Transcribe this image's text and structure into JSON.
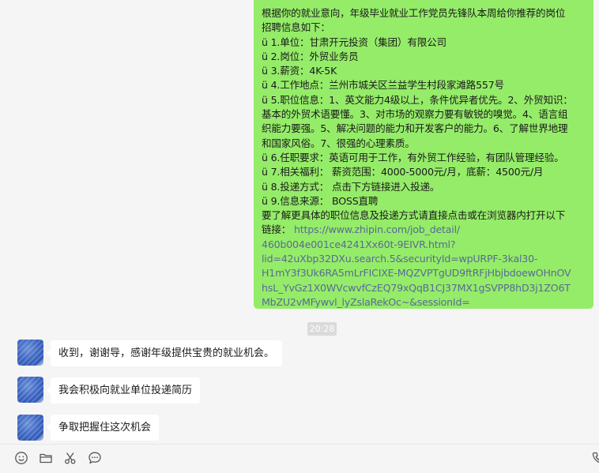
{
  "outgoing_message": {
    "lines": [
      "根据你的就业意向，年级毕业就业工作党员先锋队本周给你推荐的岗位",
      "招聘信息如下：",
      "ü 1.单位：甘肃开元投资（集团）有限公司",
      "ü 2.岗位：外贸业务员",
      "ü 3.薪资：4K-5K",
      "ü 4.工作地点：兰州市城关区兰益学生村段家滩路557号",
      "ü 5.职位信息：1、英文能力4级以上，条件优异者优先。2、外贸知识：",
      "基本的外贸术语要懂。3、对市场的观察力要有敏锐的嗅觉。4、语言组",
      "织能力要强。5、解决问题的能力和开发客户的能力。6、了解世界地理",
      "和国家风俗。7、很强的心理素质。",
      "ü 6.任职要求：英语可用于工作，有外贸工作经验，有团队管理经验。",
      "ü 7.相关福利： 薪资范围：4000-5000元/月，底薪：4500元/月",
      "ü 8.投递方式： 点击下方链接进入投递。",
      "ü 9.信息来源： BOSS直聘",
      "要了解更具体的职位信息及投递方式请直接点击或在浏览器内打开以下"
    ],
    "link_prefix": "链接：",
    "link_line1": "https://www.zhipin.com/job_detail/",
    "link_line2": "460b004e001ce4241Xx60t-9EIVR.html?",
    "link_line3": "lid=42uXbp32DXu.search.5&securityId=wpURPF-3kal30-",
    "link_line4": "H1mY3f3Uk6RA5mLrFICIXE-MQZVPTgUD9ftRFjHbjbdoewOHnOV",
    "link_line5": "hsL_YvGz1X0WVcwvfCzEQ79xQqB1CJ37MX1gSVPP8hD3j1ZO6T",
    "link_line6": "MbZU2vMFywvl_lyZslaRekOc~&sessionId="
  },
  "timestamp": "20:28",
  "incoming_messages": [
    "收到，谢谢导，感谢年级提供宝贵的就业机会。",
    "我会积极向就业单位投递简历",
    "争取把握住这次机会"
  ],
  "toolbar_icons": [
    "emoji-icon",
    "folder-icon",
    "scissors-icon",
    "chat-bubble-icon",
    "phone-icon"
  ]
}
